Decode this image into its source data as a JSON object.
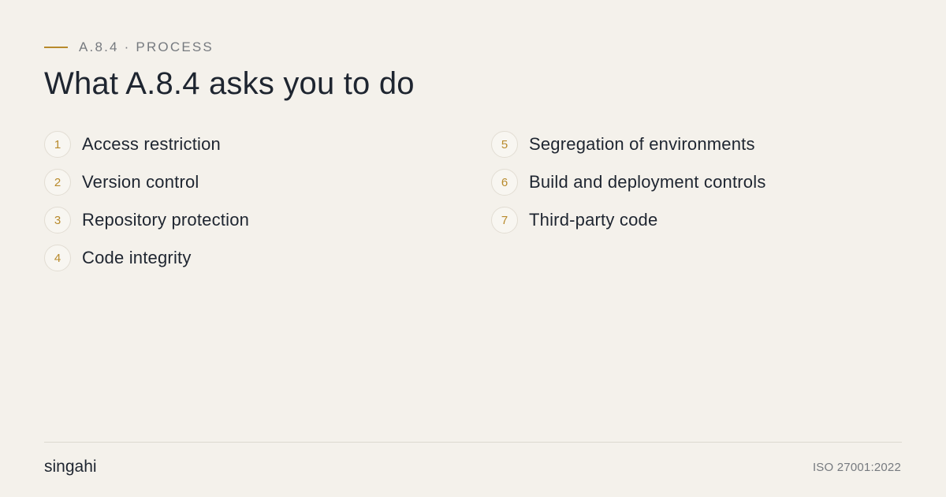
{
  "header": {
    "eyebrow": "A.8.4 · PROCESS",
    "title": "What A.8.4 asks you to do"
  },
  "steps": [
    {
      "number": "1",
      "label": "Access restriction"
    },
    {
      "number": "2",
      "label": "Version control"
    },
    {
      "number": "3",
      "label": "Repository protection"
    },
    {
      "number": "4",
      "label": "Code integrity"
    },
    {
      "number": "5",
      "label": "Segregation of environments"
    },
    {
      "number": "6",
      "label": "Build and deployment controls"
    },
    {
      "number": "7",
      "label": "Third-party code"
    }
  ],
  "footer": {
    "brand": "singahi",
    "standard": "ISO 27001:2022"
  },
  "colors": {
    "background": "#f4f1eb",
    "accent": "#b88a2c",
    "text": "#1e2530",
    "muted": "#767a7f"
  }
}
